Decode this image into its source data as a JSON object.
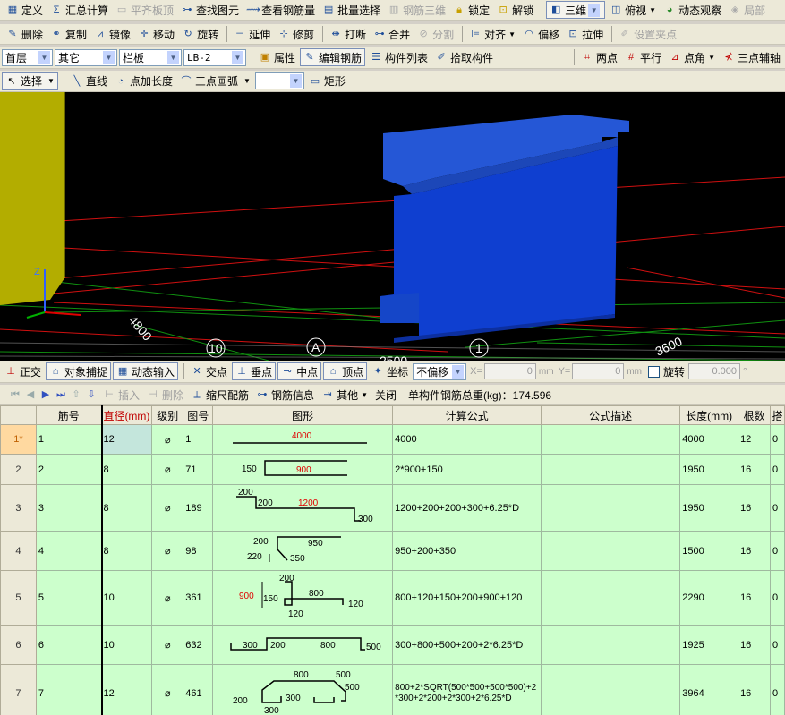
{
  "toolbar1": [
    "定义",
    "汇总计算",
    "平齐板顶",
    "查找图元",
    "查看钢筋量",
    "批量选择",
    "钢筋三维",
    "锁定",
    "解锁",
    "三维",
    "俯视",
    "动态观察",
    "局部"
  ],
  "toolbar2": [
    "删除",
    "复制",
    "镜像",
    "移动",
    "旋转",
    "延伸",
    "修剪",
    "打断",
    "合并",
    "分割",
    "对齐",
    "偏移",
    "拉伸",
    "设置夹点"
  ],
  "toolbar3": {
    "floor": "首层",
    "category": "其它",
    "type": "栏板",
    "name": "LB-2",
    "buttons": [
      "属性",
      "编辑钢筋",
      "构件列表",
      "拾取构件"
    ],
    "right": [
      "两点",
      "平行",
      "点角",
      "三点辅轴"
    ]
  },
  "toolbar4": [
    "选择",
    "直线",
    "点加长度",
    "三点画弧",
    "",
    "矩形"
  ],
  "viewport": {
    "labels": [
      "4800",
      "10",
      "A",
      "2500",
      "1",
      "3600"
    ],
    "axis": "Z"
  },
  "snapbar": {
    "buttons": [
      "正交",
      "对象捕捉",
      "动态输入",
      "交点",
      "垂点",
      "中点",
      "顶点",
      "坐标"
    ],
    "offset": "不偏移",
    "x_label": "X=",
    "x_val": "0",
    "x_unit": "mm",
    "y_label": "Y=",
    "y_val": "0",
    "y_unit": "mm",
    "rotate": "旋转",
    "rotate_val": "0.000",
    "deg": "°"
  },
  "gridbar": {
    "buttons": [
      "插入",
      "删除",
      "缩尺配筋",
      "钢筋信息",
      "其他",
      "关闭"
    ],
    "total": "单构件钢筋总重(kg)：174.596"
  },
  "grid": {
    "headers": [
      "",
      "筋号",
      "直径(mm)",
      "级别",
      "图号",
      "图形",
      "计算公式",
      "公式描述",
      "长度(mm)",
      "根数",
      "搭"
    ],
    "rows": [
      {
        "rn": "1*",
        "no": "1",
        "dia": "12",
        "grade": "⌀",
        "fig": "1",
        "formula": "4000",
        "desc": "",
        "len": "4000",
        "cnt": "12",
        "lap": "0"
      },
      {
        "rn": "2",
        "no": "2",
        "dia": "8",
        "grade": "⌀",
        "fig": "71",
        "formula": "2*900+150",
        "desc": "",
        "len": "1950",
        "cnt": "16",
        "lap": "0"
      },
      {
        "rn": "3",
        "no": "3",
        "dia": "8",
        "grade": "⌀",
        "fig": "189",
        "formula": "1200+200+200+300+6.25*D",
        "desc": "",
        "len": "1950",
        "cnt": "16",
        "lap": "0"
      },
      {
        "rn": "4",
        "no": "4",
        "dia": "8",
        "grade": "⌀",
        "fig": "98",
        "formula": "950+200+350",
        "desc": "",
        "len": "1500",
        "cnt": "16",
        "lap": "0"
      },
      {
        "rn": "5",
        "no": "5",
        "dia": "10",
        "grade": "⌀",
        "fig": "361",
        "formula": "800+120+150+200+900+120",
        "desc": "",
        "len": "2290",
        "cnt": "16",
        "lap": "0"
      },
      {
        "rn": "6",
        "no": "6",
        "dia": "10",
        "grade": "⌀",
        "fig": "632",
        "formula": "300+800+500+200+2*6.25*D",
        "desc": "",
        "len": "1925",
        "cnt": "16",
        "lap": "0"
      },
      {
        "rn": "7",
        "no": "7",
        "dia": "12",
        "grade": "⌀",
        "fig": "461",
        "formula": "800+2*SQRT(500*500+500*500)+2*300+2*200+2*300+2*6.25*D",
        "desc": "",
        "len": "3964",
        "cnt": "16",
        "lap": "0"
      }
    ],
    "shapes": {
      "s1": [
        "4000"
      ],
      "s2": [
        "150",
        "900"
      ],
      "s3": [
        "200",
        "200",
        "1200",
        "300"
      ],
      "s4": [
        "200",
        "950",
        "220",
        "350"
      ],
      "s5": [
        "200",
        "900",
        "150",
        "800",
        "120",
        "120"
      ],
      "s6": [
        "300",
        "200",
        "800",
        "500"
      ],
      "s7": [
        "800",
        "500",
        "500",
        "200",
        "300",
        "300"
      ]
    }
  }
}
